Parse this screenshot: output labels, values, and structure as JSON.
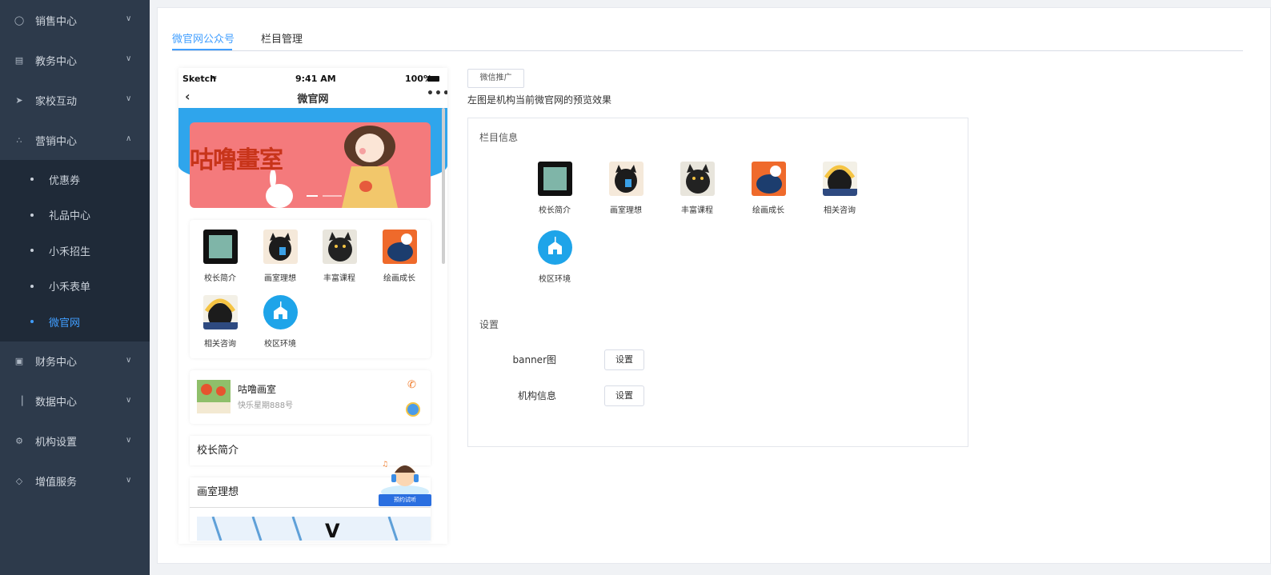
{
  "sidebar": {
    "menu": [
      {
        "label": "销售中心",
        "icon": "sales-icon"
      },
      {
        "label": "教务中心",
        "icon": "book-icon"
      },
      {
        "label": "家校互动",
        "icon": "paper-plane-icon"
      },
      {
        "label": "营销中心",
        "icon": "share-icon"
      },
      {
        "label": "财务中心",
        "icon": "finance-icon"
      },
      {
        "label": "数据中心",
        "icon": "chart-icon"
      },
      {
        "label": "机构设置",
        "icon": "gear-icon"
      },
      {
        "label": "增值服务",
        "icon": "diamond-icon"
      }
    ],
    "submenu": [
      {
        "label": "优惠券"
      },
      {
        "label": "礼品中心"
      },
      {
        "label": "小禾招生"
      },
      {
        "label": "小禾表单"
      },
      {
        "label": "微官网",
        "active": true
      }
    ],
    "colors": {
      "bg": "#2d3a4b",
      "submenu_bg": "#1f2a38",
      "active": "#409eff"
    }
  },
  "tabs": [
    {
      "label": "微官网公众号",
      "active": true
    },
    {
      "label": "栏目管理",
      "active": false
    }
  ],
  "phone": {
    "status": {
      "carrier": "Sketch",
      "time": "9:41 AM",
      "battery": "100%"
    },
    "title": "微官网",
    "banner_text": "咕噜畫室",
    "icons": [
      {
        "label": "校长简介"
      },
      {
        "label": "画室理想"
      },
      {
        "label": "丰富课程"
      },
      {
        "label": "绘画成长"
      },
      {
        "label": "相关咨询"
      },
      {
        "label": "校区环境"
      }
    ],
    "org": {
      "name": "咕噜画室",
      "address": "快乐星期888号"
    },
    "sections": [
      {
        "label": "校长简介"
      },
      {
        "label": "画室理想"
      }
    ],
    "promo_label": "预约试听"
  },
  "right": {
    "wechat_button": "微信推广",
    "note": "左图是机构当前微官网的预览效果",
    "column_heading": "栏目信息",
    "column_icons": [
      {
        "label": "校长简介"
      },
      {
        "label": "画室理想"
      },
      {
        "label": "丰富课程"
      },
      {
        "label": "绘画成长"
      },
      {
        "label": "相关咨询"
      },
      {
        "label": "校区环境"
      }
    ],
    "settings_heading": "设置",
    "settings": [
      {
        "label": "banner图",
        "button": "设置"
      },
      {
        "label": "机构信息",
        "button": "设置"
      }
    ]
  }
}
